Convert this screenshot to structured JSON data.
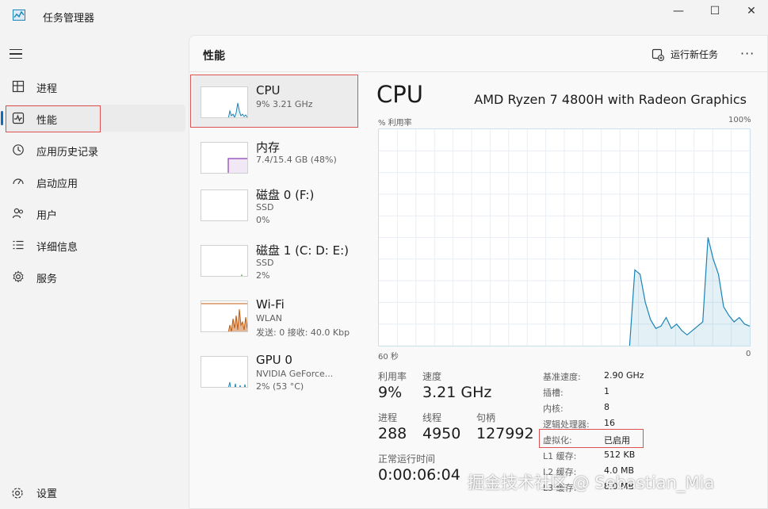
{
  "window": {
    "title": "任务管理器",
    "minimize": "—",
    "maximize": "☐",
    "close": "✕"
  },
  "sidebar": {
    "items": [
      {
        "label": "进程",
        "icon": "processes-icon"
      },
      {
        "label": "性能",
        "icon": "performance-icon"
      },
      {
        "label": "应用历史记录",
        "icon": "app-history-icon"
      },
      {
        "label": "启动应用",
        "icon": "startup-icon"
      },
      {
        "label": "用户",
        "icon": "users-icon"
      },
      {
        "label": "详细信息",
        "icon": "details-icon"
      },
      {
        "label": "服务",
        "icon": "services-icon"
      }
    ],
    "settings_label": "设置"
  },
  "header": {
    "title": "性能",
    "run_task_label": "运行新任务",
    "more_label": "···"
  },
  "resources": [
    {
      "name": "CPU",
      "sub1": "9% 3.21 GHz",
      "sub2": ""
    },
    {
      "name": "内存",
      "sub1": "7.4/15.4 GB (48%)",
      "sub2": ""
    },
    {
      "name": "磁盘 0 (F:)",
      "sub1": "SSD",
      "sub2": "0%"
    },
    {
      "name": "磁盘 1 (C: D: E:)",
      "sub1": "SSD",
      "sub2": "2%"
    },
    {
      "name": "Wi-Fi",
      "sub1": "WLAN",
      "sub2": "发送: 0 接收: 40.0 Kbp"
    },
    {
      "name": "GPU 0",
      "sub1": "NVIDIA GeForce...",
      "sub2": "2% (53 °C)"
    }
  ],
  "detail": {
    "title": "CPU",
    "model": "AMD Ryzen 7 4800H with Radeon Graphics",
    "graph_label": "% 利用率",
    "graph_max": "100%",
    "graph_time_left": "60 秒",
    "graph_time_right": "0",
    "utilization": [
      0,
      0,
      0,
      0,
      0,
      0,
      0,
      0,
      0,
      0,
      0,
      0,
      0,
      0,
      0,
      0,
      0,
      0,
      0,
      0,
      0,
      0,
      0,
      0,
      0,
      0,
      0,
      0,
      0,
      0,
      0,
      0,
      0,
      0,
      0,
      0,
      0,
      0,
      0,
      0,
      0,
      0,
      0,
      0,
      0,
      0,
      0,
      0,
      0,
      35,
      33,
      20,
      12,
      8,
      9,
      13,
      8,
      10,
      7,
      5,
      7,
      9,
      11,
      50,
      40,
      33,
      18,
      14,
      11,
      13,
      10,
      9
    ],
    "stats": {
      "util_label": "利用率",
      "util_value": "9%",
      "speed_label": "速度",
      "speed_value": "3.21 GHz",
      "proc_label": "进程",
      "proc_value": "288",
      "thread_label": "线程",
      "thread_value": "4950",
      "handle_label": "句柄",
      "handle_value": "127992",
      "uptime_label": "正常运行时间",
      "uptime_value": "0:00:06:04"
    },
    "specs": [
      {
        "label": "基准速度:",
        "value": "2.90 GHz"
      },
      {
        "label": "插槽:",
        "value": "1"
      },
      {
        "label": "内核:",
        "value": "8"
      },
      {
        "label": "逻辑处理器:",
        "value": "16"
      },
      {
        "label": "虚拟化:",
        "value": "已启用"
      },
      {
        "label": "L1 缓存:",
        "value": "512 KB"
      },
      {
        "label": "L2 缓存:",
        "value": "4.0 MB"
      },
      {
        "label": "L3 缓存:",
        "value": "8.0 MB"
      }
    ]
  },
  "watermark": "掘金技术社区 @ Sebastian_Mia",
  "colors": {
    "accent": "#0f6cbd",
    "cpu_line": "#1b83b5",
    "mem_line": "#8a3fb5",
    "wifi_line": "#c25b10",
    "highlight": "#e05050"
  }
}
